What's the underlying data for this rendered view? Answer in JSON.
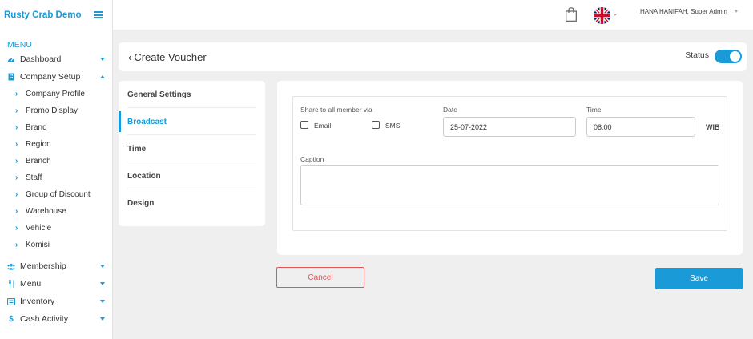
{
  "app": {
    "name": "Rusty Crab Demo"
  },
  "sidebar": {
    "heading": "MENU",
    "items_top": [
      {
        "label": "Dashboard",
        "icon": "dashboard-icon"
      },
      {
        "label": "Company Setup",
        "icon": "building-icon"
      }
    ],
    "sub_items": [
      "Company Profile",
      "Promo Display",
      "Brand",
      "Region",
      "Branch",
      "Staff",
      "Group of Discount",
      "Warehouse",
      "Vehicle",
      "Komisi"
    ],
    "items_bottom": [
      {
        "label": "Membership",
        "icon": "users-icon"
      },
      {
        "label": "Menu",
        "icon": "utensils-icon"
      },
      {
        "label": "Inventory",
        "icon": "inventory-icon"
      },
      {
        "label": "Cash Activity",
        "icon": "dollar-icon"
      }
    ]
  },
  "topbar": {
    "user": "HANA HANIFAH, Super Admin"
  },
  "header": {
    "title": "Create Voucher",
    "status_label": "Status",
    "status_on": true
  },
  "tabs": [
    {
      "label": "General Settings",
      "active": false
    },
    {
      "label": "Broadcast",
      "active": true
    },
    {
      "label": "Time",
      "active": false
    },
    {
      "label": "Location",
      "active": false
    },
    {
      "label": "Design",
      "active": false
    }
  ],
  "form": {
    "share_label": "Share to all member via",
    "email_label": "Email",
    "sms_label": "SMS",
    "date_label": "Date",
    "date_value": "25-07-2022",
    "time_label": "Time",
    "time_value": "08:00",
    "timezone": "WIB",
    "caption_label": "Caption",
    "caption_value": ""
  },
  "actions": {
    "cancel_label": "Cancel",
    "save_label": "Save"
  },
  "colors": {
    "accent": "#1a9bd7",
    "danger": "#e05555"
  }
}
